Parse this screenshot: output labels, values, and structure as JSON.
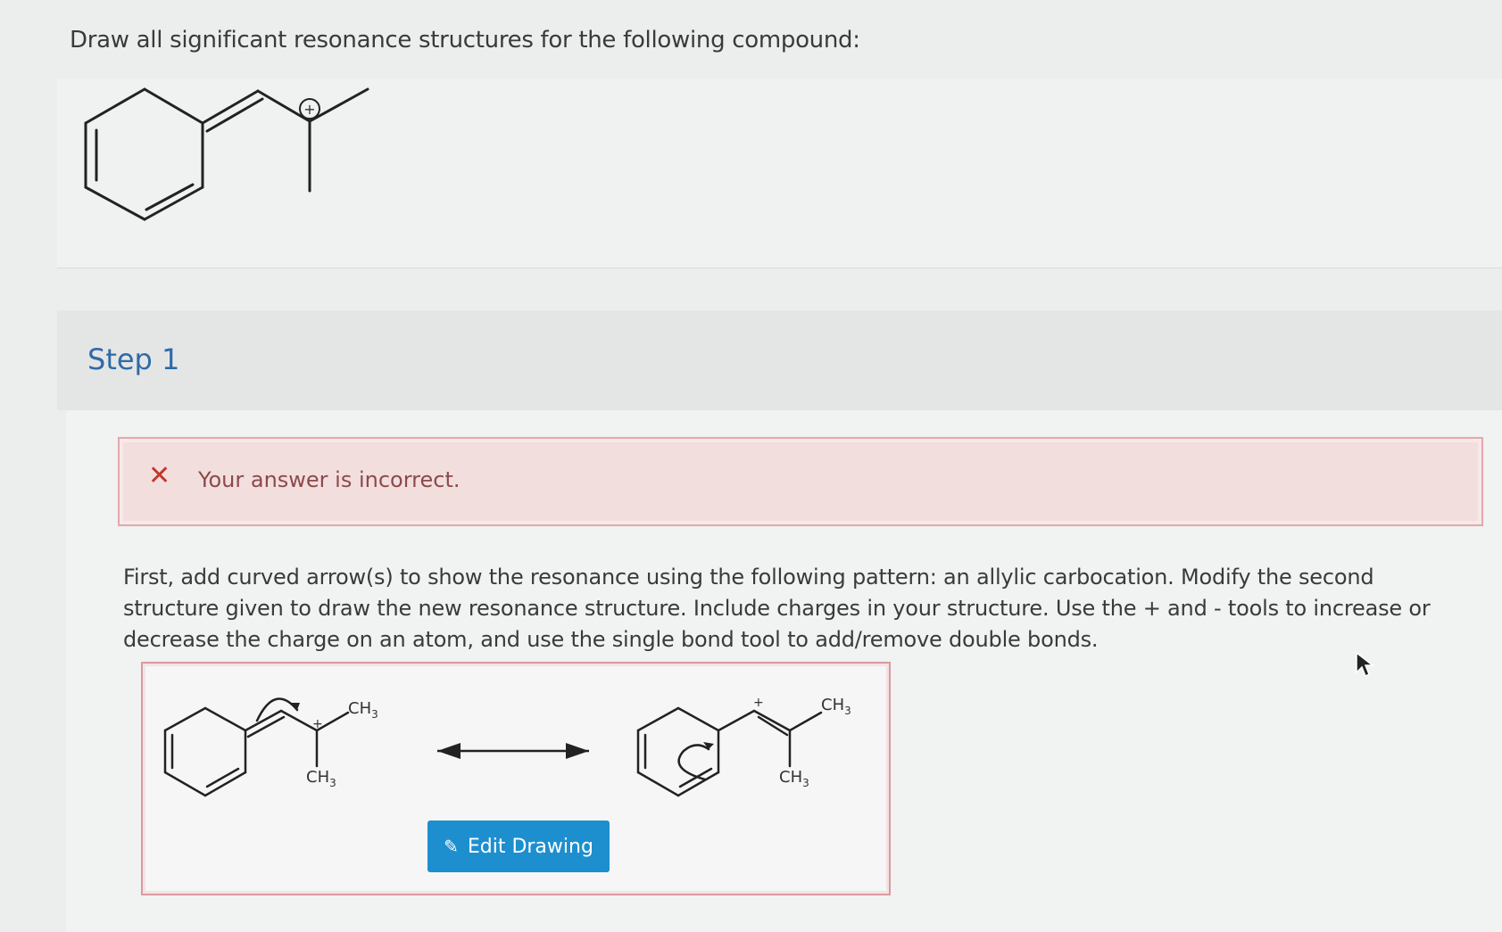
{
  "question": {
    "text": "Draw all significant resonance structures for the following compound:",
    "charge_symbol": "+"
  },
  "step": {
    "title": "Step 1"
  },
  "feedback": {
    "icon": "x-icon",
    "message": "Your answer is incorrect."
  },
  "instructions": {
    "text": "First, add curved arrow(s) to show the resonance using the following pattern: an allylic carbocation. Modify the second structure given to draw the new resonance structure. Include charges in your structure. Use the + and - tools to increase or decrease the charge on an atom, and use the single bond tool to add/remove double bonds."
  },
  "answer": {
    "structure1": {
      "methyl_top": "CH",
      "methyl_top_sub": "3",
      "methyl_bottom": "CH",
      "methyl_bottom_sub": "3",
      "charge": "+"
    },
    "structure2": {
      "methyl_top": "CH",
      "methyl_top_sub": "3",
      "methyl_bottom": "CH",
      "methyl_bottom_sub": "3",
      "charge": "+"
    },
    "edit_button_label": "Edit Drawing"
  },
  "colors": {
    "step_title": "#2f6aa8",
    "error_icon": "#c0392b",
    "error_background": "#f3dede",
    "button": "#1d8fcf"
  }
}
